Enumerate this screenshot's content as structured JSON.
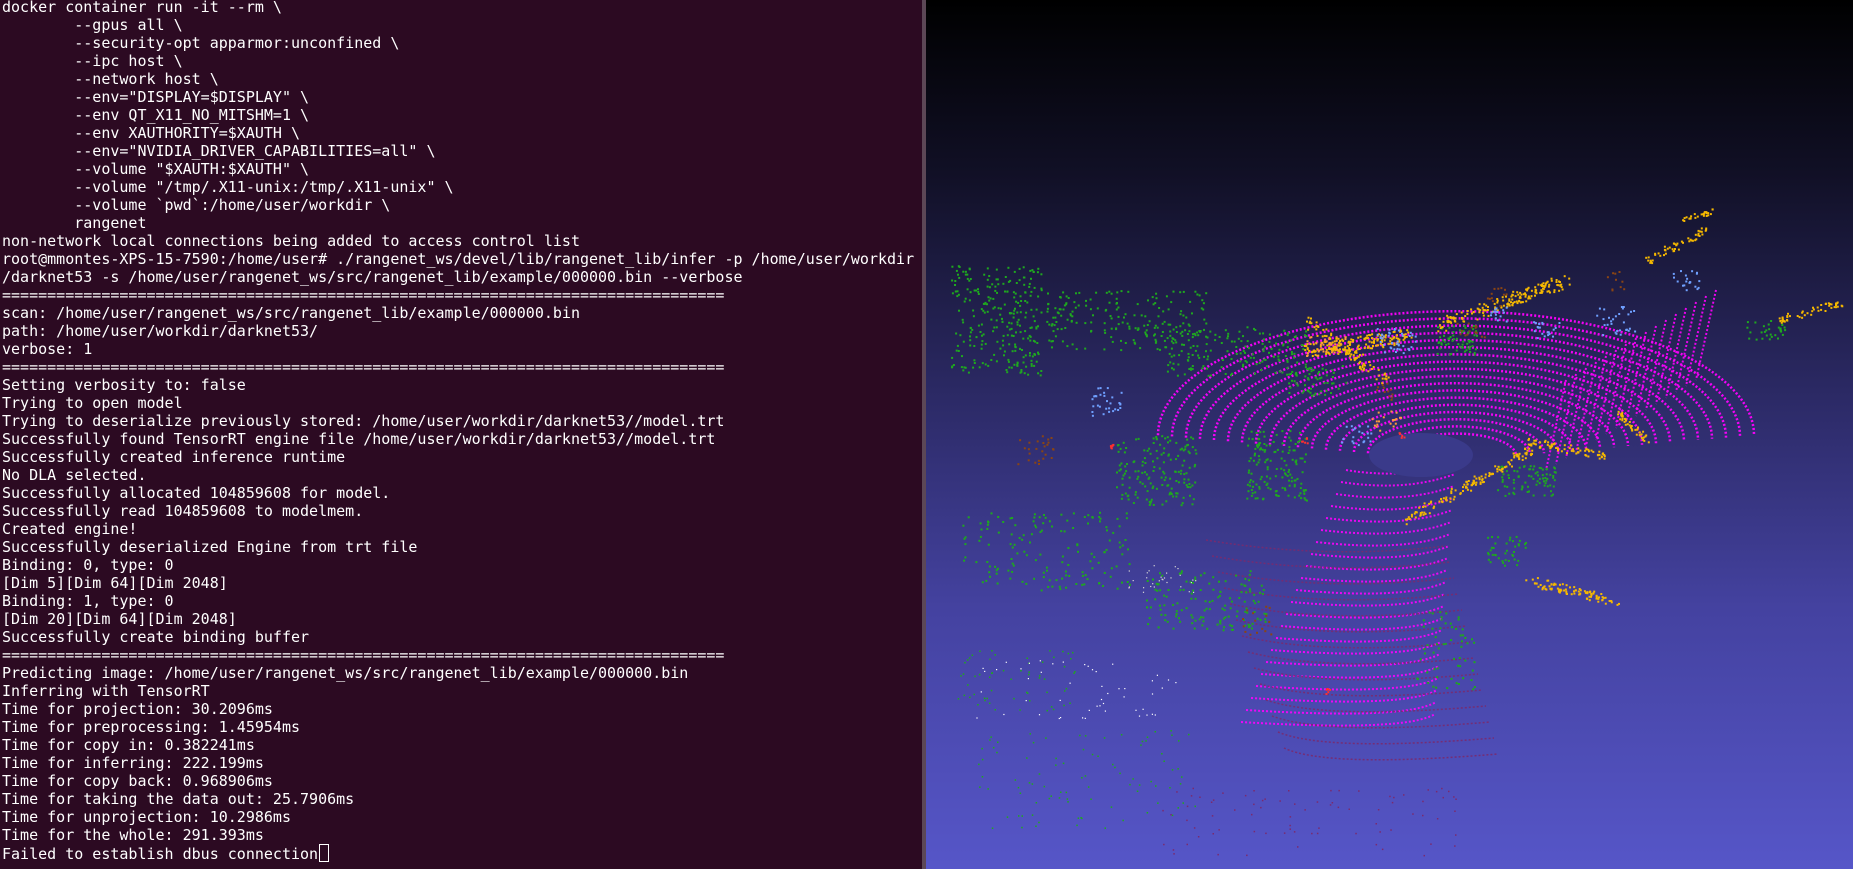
{
  "terminal": {
    "lines": [
      "docker container run -it --rm \\",
      "        --gpus all \\",
      "        --security-opt apparmor:unconfined \\",
      "        --ipc host \\",
      "        --network host \\",
      "        --env=\"DISPLAY=$DISPLAY\" \\",
      "        --env QT_X11_NO_MITSHM=1 \\",
      "        --env XAUTHORITY=$XAUTH \\",
      "        --env=\"NVIDIA_DRIVER_CAPABILITIES=all\" \\",
      "        --volume \"$XAUTH:$XAUTH\" \\",
      "        --volume \"/tmp/.X11-unix:/tmp/.X11-unix\" \\",
      "        --volume `pwd`:/home/user/workdir \\",
      "        rangenet",
      "non-network local connections being added to access control list",
      "root@mmontes-XPS-15-7590:/home/user# ./rangenet_ws/devel/lib/rangenet_lib/infer -p /home/user/workdir",
      "/darknet53 -s /home/user/rangenet_ws/src/rangenet_lib/example/000000.bin --verbose",
      "================================================================================",
      "scan: /home/user/rangenet_ws/src/rangenet_lib/example/000000.bin",
      "path: /home/user/workdir/darknet53/",
      "verbose: 1",
      "================================================================================",
      "Setting verbosity to: false",
      "Trying to open model",
      "Trying to deserialize previously stored: /home/user/workdir/darknet53//model.trt",
      "Successfully found TensorRT engine file /home/user/workdir/darknet53//model.trt",
      "Successfully created inference runtime",
      "No DLA selected.",
      "Successfully allocated 104859608 for model.",
      "Successfully read 104859608 to modelmem.",
      "Created engine!",
      "Successfully deserialized Engine from trt file",
      "Binding: 0, type: 0",
      "[Dim 5][Dim 64][Dim 2048]",
      "Binding: 1, type: 0",
      "[Dim 20][Dim 64][Dim 2048]",
      "Successfully create binding buffer",
      "================================================================================",
      "Predicting image: /home/user/rangenet_ws/src/rangenet_lib/example/000000.bin",
      "Inferring with TensorRT",
      "Time for projection: 30.2096ms",
      "Time for preprocessing: 1.45954ms",
      "Time for copy in: 0.382241ms",
      "Time for inferring: 222.199ms",
      "Time for copy back: 0.968906ms",
      "Time for taking the data out: 25.7906ms",
      "Time for unprojection: 10.2986ms",
      "Time for the whole: 291.393ms",
      "Failed to establish dbus connection"
    ],
    "colors": {
      "background": "#2c0a22",
      "text": "#ffffff"
    }
  },
  "viewer": {
    "colors": {
      "road": "#ff00ff",
      "road_dark": "#7a2a6e",
      "vegetation": "#1fa81f",
      "car": "#f5b800",
      "building": "#ff9a3c",
      "pole": "#6fa0ff",
      "trunk": "#8b4513",
      "person": "#ff3030",
      "background_top": "#000000",
      "background_bottom": "#5656c8"
    }
  }
}
